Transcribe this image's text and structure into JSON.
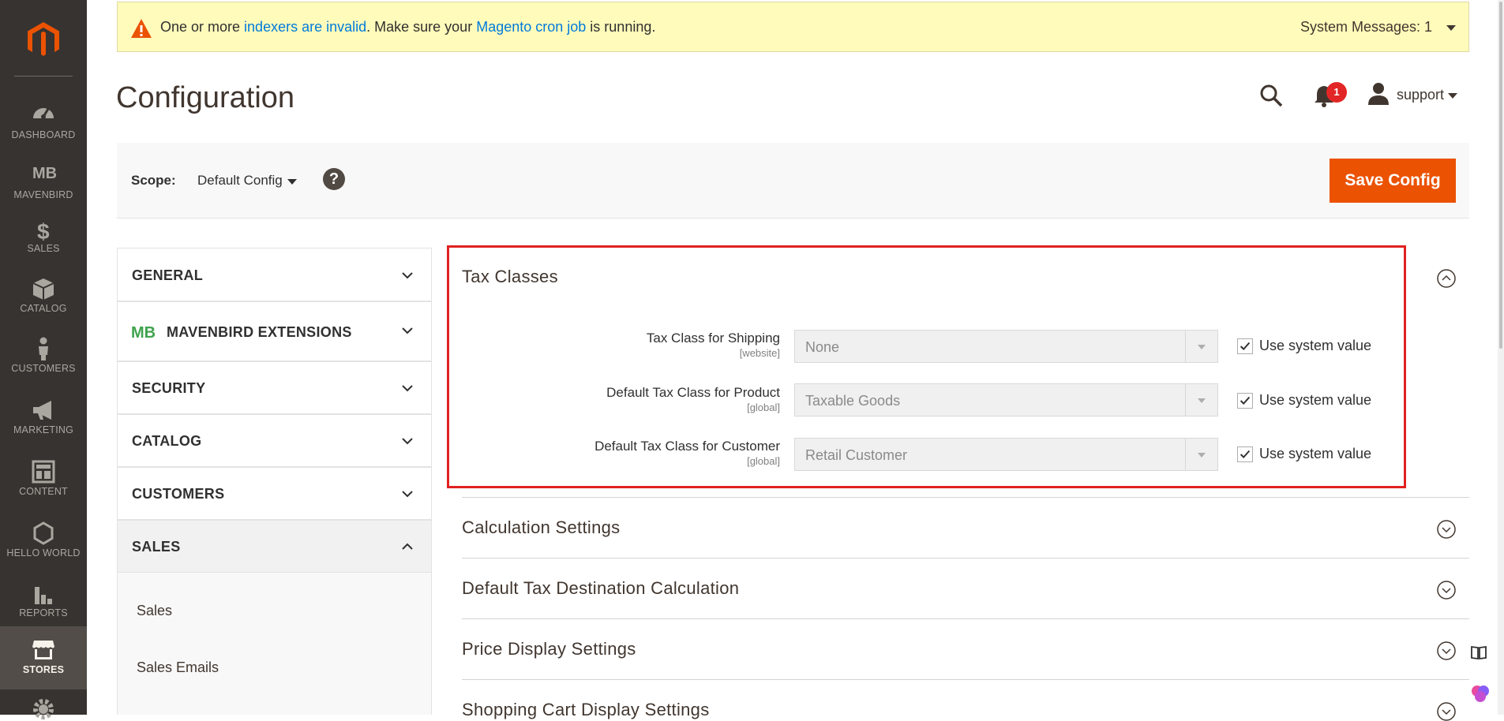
{
  "nav": {
    "items": [
      {
        "label": "DASHBOARD",
        "icon": "dashboard-icon"
      },
      {
        "label": "MAVENBIRD",
        "icon": "mavenbird-icon"
      },
      {
        "label": "SALES",
        "icon": "dollar-icon"
      },
      {
        "label": "CATALOG",
        "icon": "box-icon"
      },
      {
        "label": "CUSTOMERS",
        "icon": "person-icon"
      },
      {
        "label": "MARKETING",
        "icon": "megaphone-icon"
      },
      {
        "label": "CONTENT",
        "icon": "layout-icon"
      },
      {
        "label": "HELLO WORLD",
        "icon": "hexagon-icon"
      },
      {
        "label": "REPORTS",
        "icon": "bar-chart-icon"
      },
      {
        "label": "STORES",
        "icon": "store-icon"
      }
    ],
    "active": "STORES",
    "logo_icon": "magento-logo-icon"
  },
  "system_message": {
    "text_1": "One or more ",
    "link_1": "indexers are invalid",
    "text_2": ". Make sure your ",
    "link_2": "Magento cron job",
    "text_3": " is running.",
    "count_label": "System Messages: 1"
  },
  "header": {
    "title": "Configuration",
    "notification_count": "1",
    "user_name": "support"
  },
  "scope": {
    "label": "Scope:",
    "value": "Default Config",
    "help": "?",
    "save_label": "Save Config"
  },
  "tabs": {
    "general": "GENERAL",
    "mavenbird": "MAVENBIRD EXTENSIONS",
    "security": "SECURITY",
    "catalog": "CATALOG",
    "customers": "CUSTOMERS",
    "sales": "SALES",
    "sales_items": [
      "Sales",
      "Sales Emails"
    ]
  },
  "tax_classes": {
    "title": "Tax Classes",
    "fields": [
      {
        "label": "Tax Class for Shipping",
        "scope": "[website]",
        "value": "None",
        "use_system": "Use system value"
      },
      {
        "label": "Default Tax Class for Product",
        "scope": "[global]",
        "value": "Taxable Goods",
        "use_system": "Use system value"
      },
      {
        "label": "Default Tax Class for Customer",
        "scope": "[global]",
        "value": "Retail Customer",
        "use_system": "Use system value"
      }
    ]
  },
  "sections": [
    "Calculation Settings",
    "Default Tax Destination Calculation",
    "Price Display Settings",
    "Shopping Cart Display Settings"
  ],
  "colors": {
    "nav_bg": "#373330",
    "accent": "#eb5202",
    "highlight_border": "#e02121",
    "link": "#007bdb"
  }
}
